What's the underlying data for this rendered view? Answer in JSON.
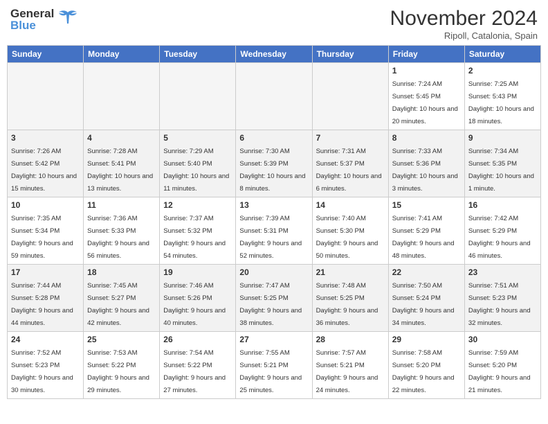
{
  "header": {
    "logo_general": "General",
    "logo_blue": "Blue",
    "month_year": "November 2024",
    "location": "Ripoll, Catalonia, Spain"
  },
  "calendar": {
    "days_of_week": [
      "Sunday",
      "Monday",
      "Tuesday",
      "Wednesday",
      "Thursday",
      "Friday",
      "Saturday"
    ],
    "weeks": [
      [
        {
          "day": "",
          "info": ""
        },
        {
          "day": "",
          "info": ""
        },
        {
          "day": "",
          "info": ""
        },
        {
          "day": "",
          "info": ""
        },
        {
          "day": "",
          "info": ""
        },
        {
          "day": "1",
          "info": "Sunrise: 7:24 AM\nSunset: 5:45 PM\nDaylight: 10 hours and 20 minutes."
        },
        {
          "day": "2",
          "info": "Sunrise: 7:25 AM\nSunset: 5:43 PM\nDaylight: 10 hours and 18 minutes."
        }
      ],
      [
        {
          "day": "3",
          "info": "Sunrise: 7:26 AM\nSunset: 5:42 PM\nDaylight: 10 hours and 15 minutes."
        },
        {
          "day": "4",
          "info": "Sunrise: 7:28 AM\nSunset: 5:41 PM\nDaylight: 10 hours and 13 minutes."
        },
        {
          "day": "5",
          "info": "Sunrise: 7:29 AM\nSunset: 5:40 PM\nDaylight: 10 hours and 11 minutes."
        },
        {
          "day": "6",
          "info": "Sunrise: 7:30 AM\nSunset: 5:39 PM\nDaylight: 10 hours and 8 minutes."
        },
        {
          "day": "7",
          "info": "Sunrise: 7:31 AM\nSunset: 5:37 PM\nDaylight: 10 hours and 6 minutes."
        },
        {
          "day": "8",
          "info": "Sunrise: 7:33 AM\nSunset: 5:36 PM\nDaylight: 10 hours and 3 minutes."
        },
        {
          "day": "9",
          "info": "Sunrise: 7:34 AM\nSunset: 5:35 PM\nDaylight: 10 hours and 1 minute."
        }
      ],
      [
        {
          "day": "10",
          "info": "Sunrise: 7:35 AM\nSunset: 5:34 PM\nDaylight: 9 hours and 59 minutes."
        },
        {
          "day": "11",
          "info": "Sunrise: 7:36 AM\nSunset: 5:33 PM\nDaylight: 9 hours and 56 minutes."
        },
        {
          "day": "12",
          "info": "Sunrise: 7:37 AM\nSunset: 5:32 PM\nDaylight: 9 hours and 54 minutes."
        },
        {
          "day": "13",
          "info": "Sunrise: 7:39 AM\nSunset: 5:31 PM\nDaylight: 9 hours and 52 minutes."
        },
        {
          "day": "14",
          "info": "Sunrise: 7:40 AM\nSunset: 5:30 PM\nDaylight: 9 hours and 50 minutes."
        },
        {
          "day": "15",
          "info": "Sunrise: 7:41 AM\nSunset: 5:29 PM\nDaylight: 9 hours and 48 minutes."
        },
        {
          "day": "16",
          "info": "Sunrise: 7:42 AM\nSunset: 5:29 PM\nDaylight: 9 hours and 46 minutes."
        }
      ],
      [
        {
          "day": "17",
          "info": "Sunrise: 7:44 AM\nSunset: 5:28 PM\nDaylight: 9 hours and 44 minutes."
        },
        {
          "day": "18",
          "info": "Sunrise: 7:45 AM\nSunset: 5:27 PM\nDaylight: 9 hours and 42 minutes."
        },
        {
          "day": "19",
          "info": "Sunrise: 7:46 AM\nSunset: 5:26 PM\nDaylight: 9 hours and 40 minutes."
        },
        {
          "day": "20",
          "info": "Sunrise: 7:47 AM\nSunset: 5:25 PM\nDaylight: 9 hours and 38 minutes."
        },
        {
          "day": "21",
          "info": "Sunrise: 7:48 AM\nSunset: 5:25 PM\nDaylight: 9 hours and 36 minutes."
        },
        {
          "day": "22",
          "info": "Sunrise: 7:50 AM\nSunset: 5:24 PM\nDaylight: 9 hours and 34 minutes."
        },
        {
          "day": "23",
          "info": "Sunrise: 7:51 AM\nSunset: 5:23 PM\nDaylight: 9 hours and 32 minutes."
        }
      ],
      [
        {
          "day": "24",
          "info": "Sunrise: 7:52 AM\nSunset: 5:23 PM\nDaylight: 9 hours and 30 minutes."
        },
        {
          "day": "25",
          "info": "Sunrise: 7:53 AM\nSunset: 5:22 PM\nDaylight: 9 hours and 29 minutes."
        },
        {
          "day": "26",
          "info": "Sunrise: 7:54 AM\nSunset: 5:22 PM\nDaylight: 9 hours and 27 minutes."
        },
        {
          "day": "27",
          "info": "Sunrise: 7:55 AM\nSunset: 5:21 PM\nDaylight: 9 hours and 25 minutes."
        },
        {
          "day": "28",
          "info": "Sunrise: 7:57 AM\nSunset: 5:21 PM\nDaylight: 9 hours and 24 minutes."
        },
        {
          "day": "29",
          "info": "Sunrise: 7:58 AM\nSunset: 5:20 PM\nDaylight: 9 hours and 22 minutes."
        },
        {
          "day": "30",
          "info": "Sunrise: 7:59 AM\nSunset: 5:20 PM\nDaylight: 9 hours and 21 minutes."
        }
      ]
    ]
  }
}
